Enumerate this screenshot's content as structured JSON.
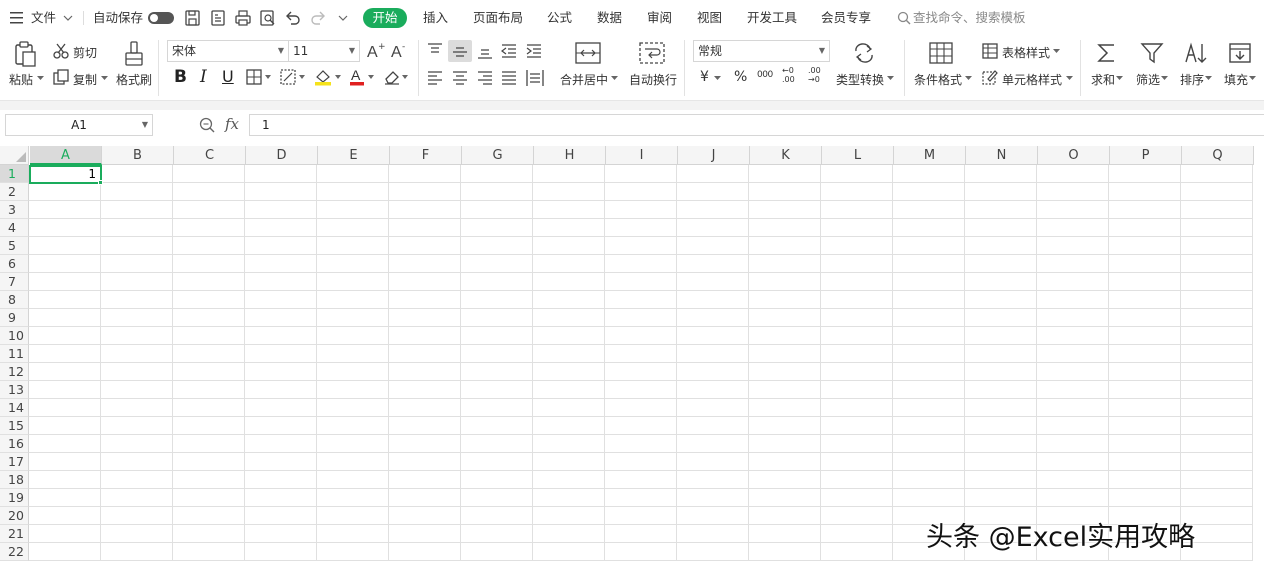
{
  "topbar": {
    "menu_label": "文件",
    "autosave_label": "自动保存",
    "tabs": [
      {
        "label": "开始",
        "active": true
      },
      {
        "label": "插入"
      },
      {
        "label": "页面布局"
      },
      {
        "label": "公式"
      },
      {
        "label": "数据"
      },
      {
        "label": "审阅"
      },
      {
        "label": "视图"
      },
      {
        "label": "开发工具"
      },
      {
        "label": "会员专享"
      }
    ],
    "search_placeholder": "查找命令、搜索模板",
    "accent_color": "#1aac5c"
  },
  "ribbon": {
    "paste": "粘贴",
    "cut": "剪切",
    "copy": "复制",
    "format_painter": "格式刷",
    "font_name": "宋体",
    "font_size": "11",
    "bold": "B",
    "italic": "I",
    "underline": "U",
    "number_format": "常规",
    "merge_center": "合并居中",
    "wrap_text": "自动换行",
    "currency": "¥",
    "percent": "%",
    "thousands": "000",
    "inc_decimal": "←0\n.00",
    "dec_decimal": ".00\n→0",
    "type_convert": "类型转换",
    "conditional_format": "条件格式",
    "table_style": "表格样式",
    "cell_style": "单元格样式",
    "sum": "求和",
    "filter": "筛选",
    "sort": "排序",
    "fill": "填充"
  },
  "formula_bar": {
    "name_box": "A1",
    "fx_label": "fx",
    "formula": "1"
  },
  "sheet": {
    "columns": [
      "A",
      "B",
      "C",
      "D",
      "E",
      "F",
      "G",
      "H",
      "I",
      "J",
      "K",
      "L",
      "M",
      "N",
      "O",
      "P",
      "Q"
    ],
    "rows": [
      "1",
      "2",
      "3",
      "4",
      "5",
      "6",
      "7",
      "8",
      "9",
      "10",
      "11",
      "12",
      "13",
      "14",
      "15",
      "16",
      "17",
      "18",
      "19",
      "20",
      "21",
      "22"
    ],
    "selected_cell": "A1",
    "cells": {
      "A1": "1"
    }
  },
  "watermark": "头条 @Excel实用攻略"
}
